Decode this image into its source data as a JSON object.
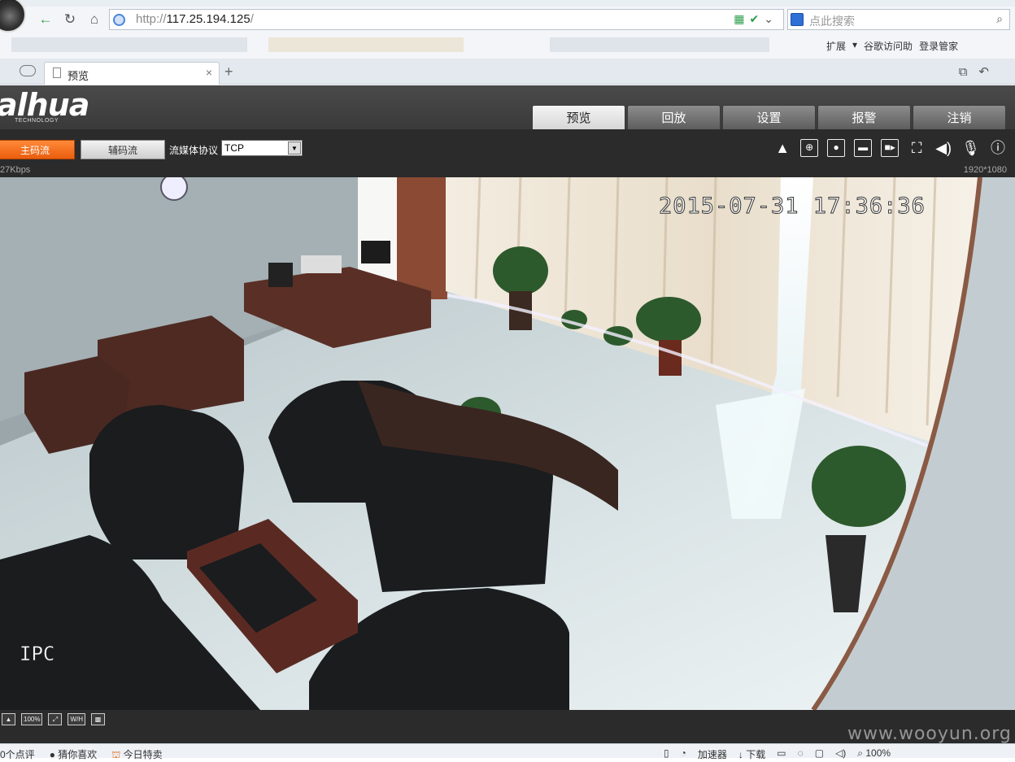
{
  "browser": {
    "url_host": "117.25.194.125",
    "url_prefix": "http://",
    "url_suffix": "/",
    "search_placeholder": "点此搜索",
    "tab_title": "预览",
    "extensions": [
      "扩展",
      "谷歌访问助",
      "登录管家"
    ]
  },
  "app": {
    "logo": "alhua",
    "logo_sub": "TECHNOLOGY",
    "tabs": [
      "预览",
      "回放",
      "设置",
      "报警",
      "注销"
    ],
    "active_tab": "预览",
    "main_stream": "主码流",
    "sub_stream": "辅码流",
    "protocol_label": "流媒体协议",
    "protocol_value": "TCP",
    "bitrate": "27Kbps",
    "resolution": "1920*1080",
    "zoom_label": "100%",
    "wh_label": "W/H",
    "icons": [
      "alarm-bell-icon",
      "zoom-region-icon",
      "snapshot-icon",
      "record-icon",
      "video-icon",
      "fullscreen-icon",
      "volume-icon",
      "microphone-icon",
      "help-icon"
    ]
  },
  "video": {
    "timestamp": "2015-07-31 17:36:36",
    "channel_name": "IPC"
  },
  "status_bar": {
    "left": [
      "0个点评",
      "猜你喜欢",
      "今日特卖"
    ],
    "right": [
      "加速器",
      "下载",
      "100%"
    ]
  },
  "watermark": "www.wooyun.org"
}
